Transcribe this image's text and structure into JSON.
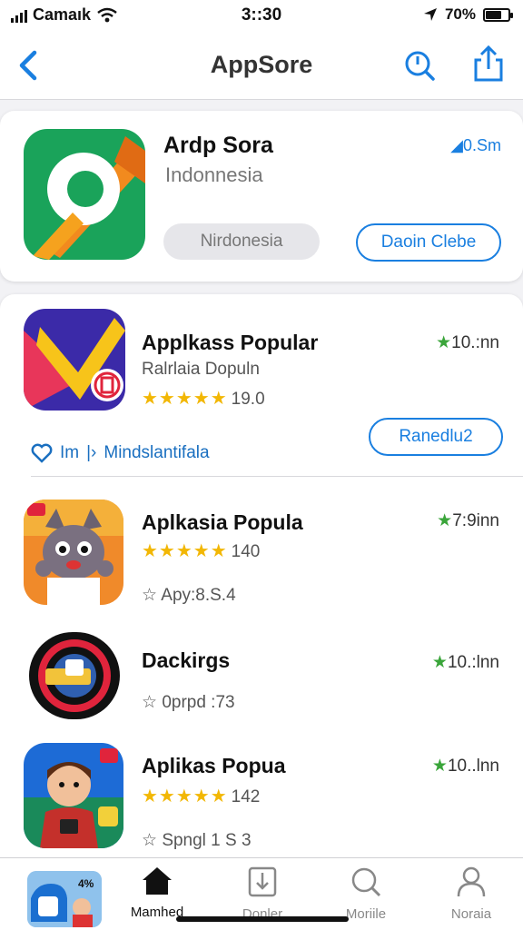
{
  "status_bar": {
    "carrier": "Camaık",
    "time": "3::30",
    "battery": "70%",
    "battery_level": 0.7
  },
  "nav": {
    "title": "AppSore"
  },
  "featured": {
    "name": "Ardp Sora",
    "subtitle": "Indonnesia",
    "meta": "0.Sm",
    "tag_button": "Nirdonesia",
    "action_button": "Daoin Clebe"
  },
  "apps": [
    {
      "name": "Applkass Popular",
      "subtitle": "Ralrlaia Dopuln",
      "rating": "★★★★★",
      "rating_value": "19.0",
      "count": "10.:nn",
      "promo_label": "Im",
      "promo_text": "Mindslantifala",
      "action_button": "Ranedlu2"
    },
    {
      "name": "Aplkasia Popula",
      "rating": "★★★★★",
      "rating_value": "140",
      "count": "7:9inn",
      "meta": "Apy:8.S.4"
    },
    {
      "name": "Dackirgs",
      "count": "10.:lnn",
      "meta": "0prpd :73"
    },
    {
      "name": "Aplikas Popua",
      "rating": "★★★★★",
      "rating_value": "142",
      "count": "10..lnn",
      "meta": "Spngl 1 S 3"
    }
  ],
  "tabs": [
    {
      "label": "Mamhed",
      "icon": "home-icon"
    },
    {
      "label": "Donler",
      "icon": "download-icon"
    },
    {
      "label": "Moriile",
      "icon": "search-icon"
    },
    {
      "label": "Noraia",
      "icon": "person-icon"
    }
  ],
  "colors": {
    "accent": "#1a7fe0",
    "star": "#f2b705",
    "green": "#3aa53a"
  }
}
